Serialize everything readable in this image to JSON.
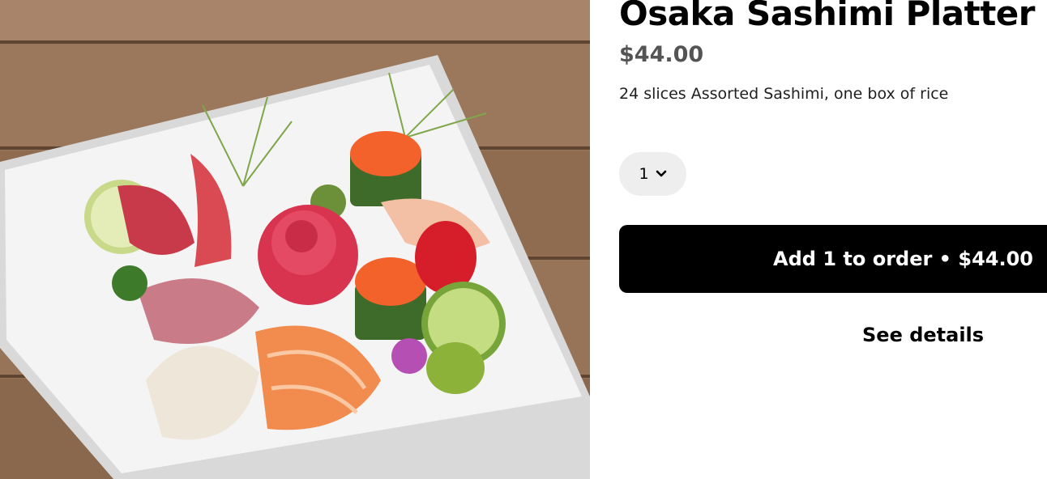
{
  "item": {
    "title": "Osaka Sashimi Platter",
    "price": "$44.00",
    "description": "24 slices Assorted Sashimi, one box of rice"
  },
  "quantity": {
    "value": "1",
    "icon": "chevron-down-icon"
  },
  "actions": {
    "add_label": "Add 1 to order • $44.00",
    "details_label": "See details"
  },
  "colors": {
    "primary_button": "#000000",
    "qty_pill": "#eeeeee",
    "price_text": "#545454"
  }
}
